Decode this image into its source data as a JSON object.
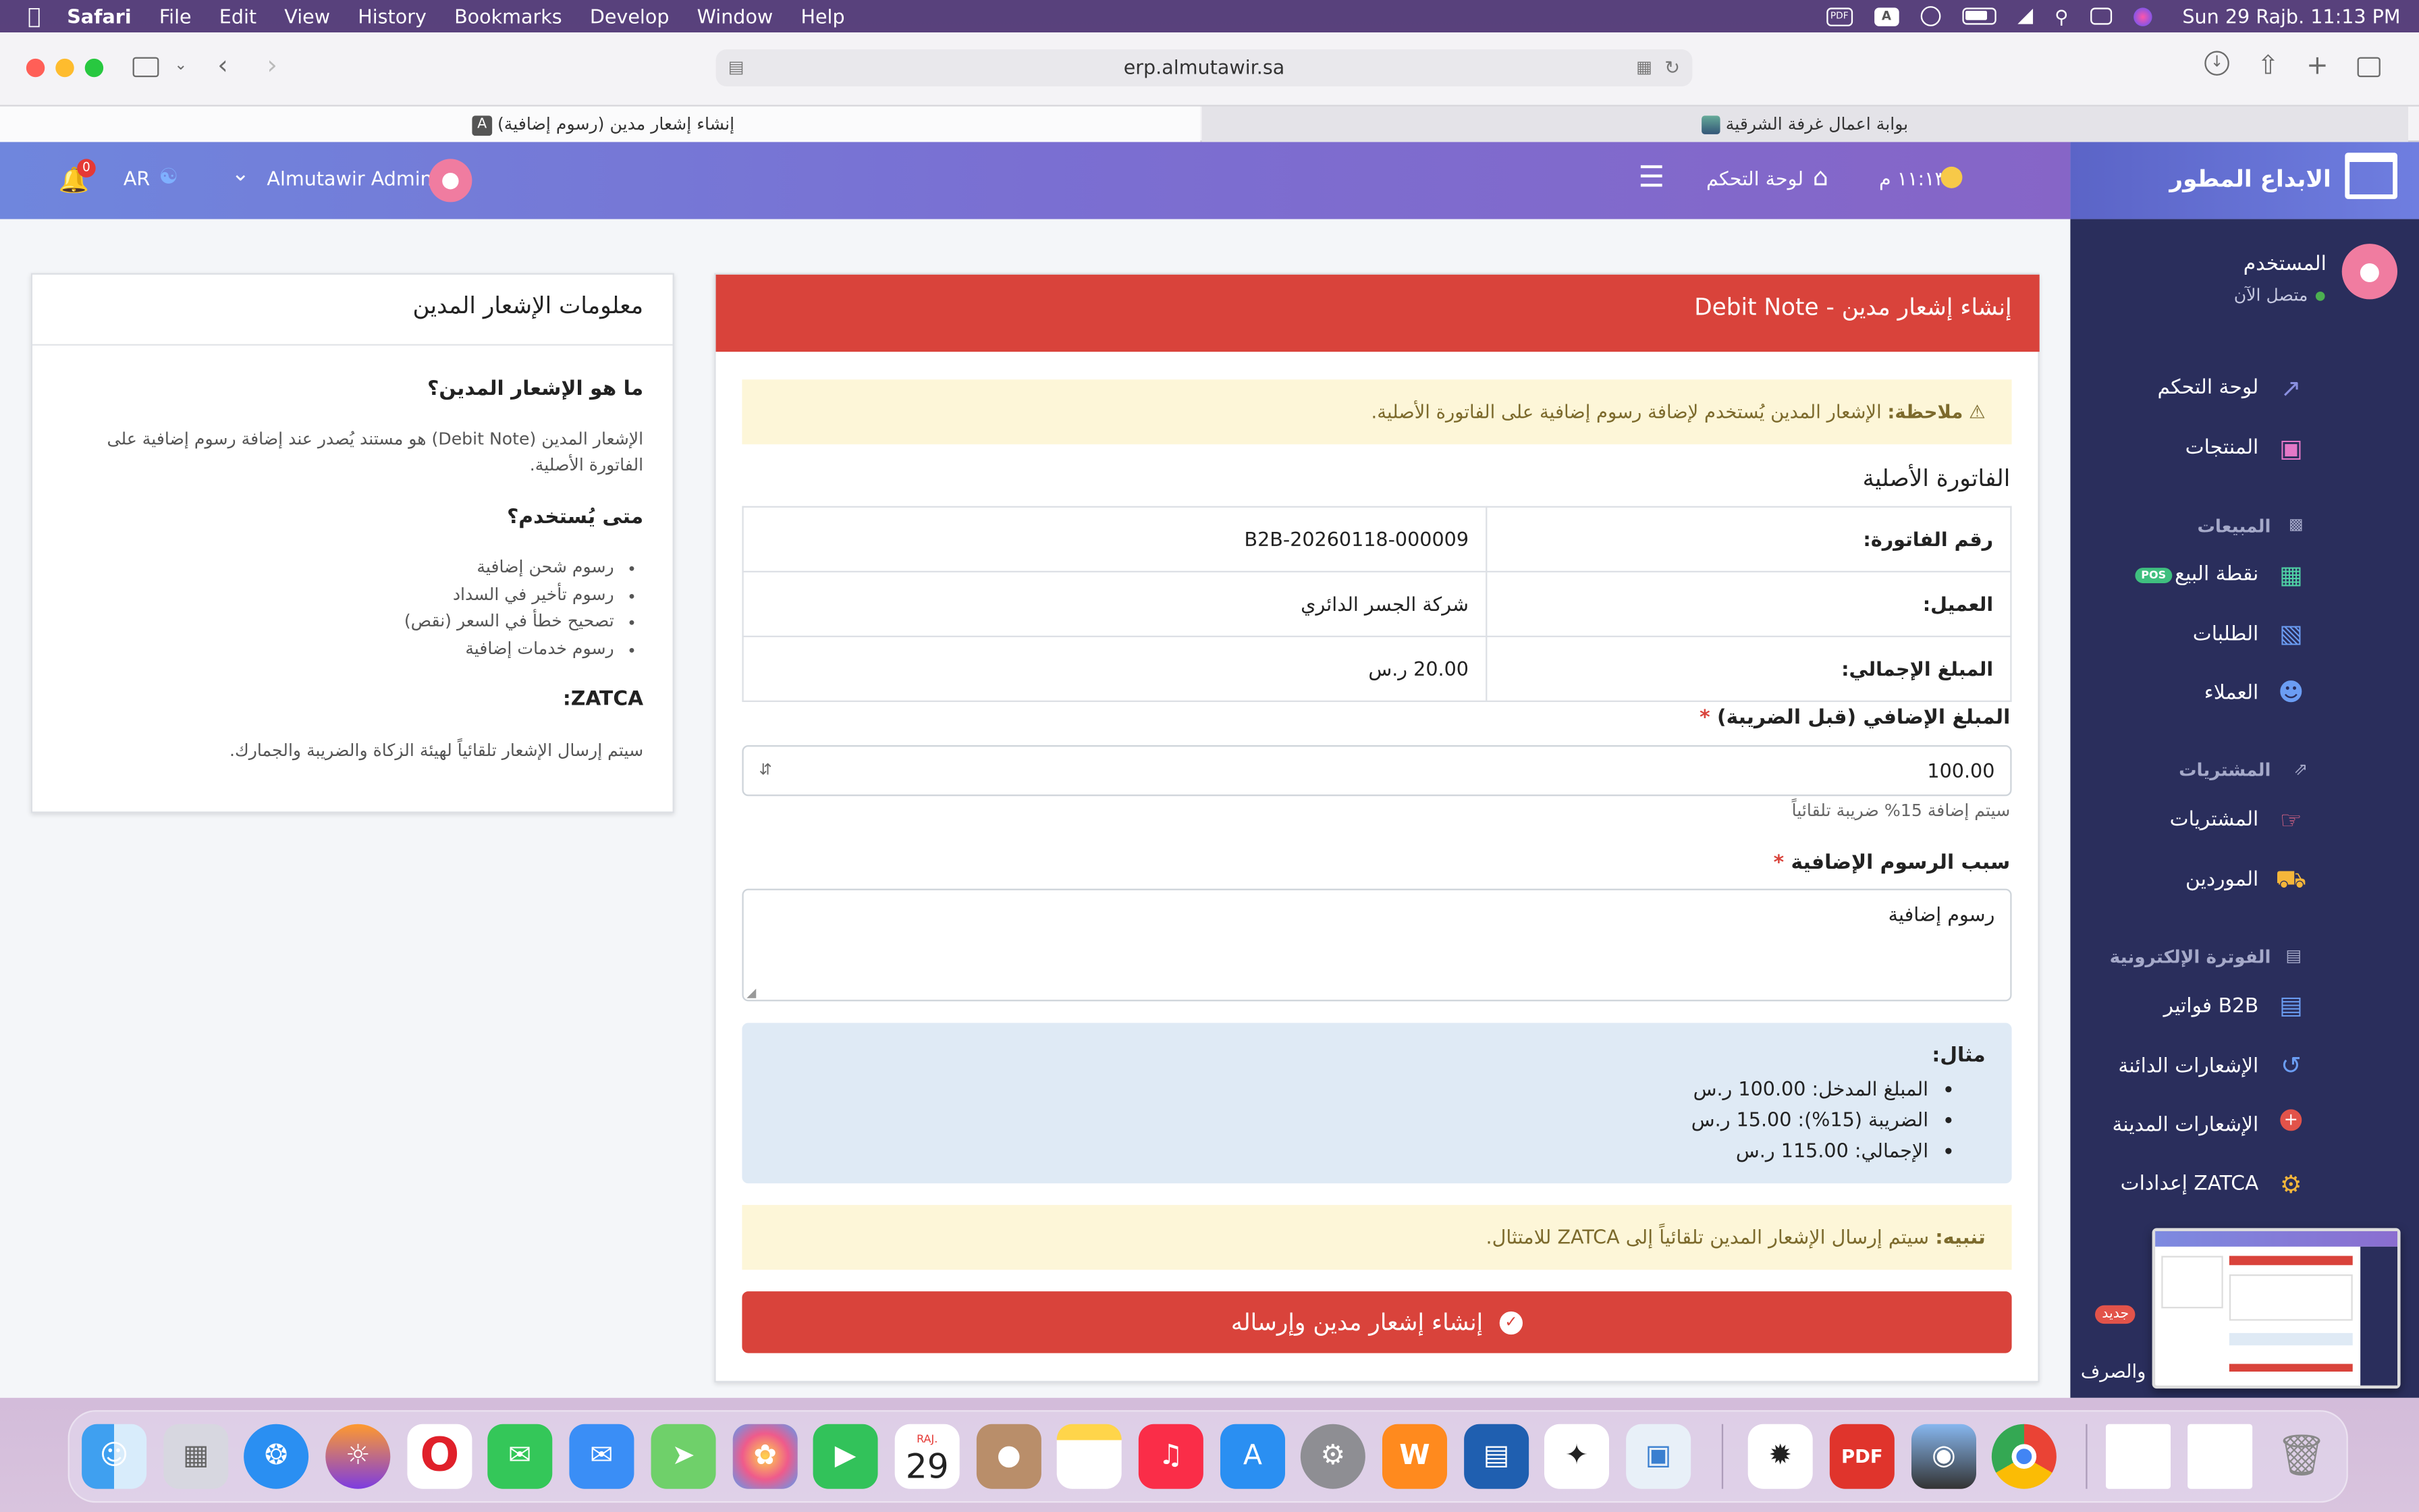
{
  "menubar": {
    "apple": "",
    "app": "Safari",
    "items": [
      "File",
      "Edit",
      "View",
      "History",
      "Bookmarks",
      "Develop",
      "Window",
      "Help"
    ],
    "pdf_badge": "PDF",
    "a_badge": "A",
    "datetime": "Sun 29 Rajb.  11:13 PM"
  },
  "browser": {
    "url": "erp.almutawir.sa",
    "tabs": [
      {
        "title": "إنشاء إشعار مدين (رسوم إضافية)",
        "fav": "A"
      },
      {
        "title": "بوابة اعمال غرفة الشرقية"
      }
    ]
  },
  "topnav": {
    "notif_count": "0",
    "lang": "AR",
    "user": "Almutawir Admin",
    "dashboard": "لوحة التحكم",
    "time": "١١:١٣ م"
  },
  "sidebar": {
    "brand": "الابداع المطور",
    "user_name": "المستخدم",
    "user_status": "متصل الآن",
    "items": [
      {
        "label": "لوحة التحكم"
      },
      {
        "label": "المنتجات"
      },
      {
        "section": "المبيعات"
      },
      {
        "label": "نقطة البيع",
        "badge": "POS"
      },
      {
        "label": "الطلبات"
      },
      {
        "label": "العملاء"
      },
      {
        "section": "المشتريات"
      },
      {
        "label": "المشتريات"
      },
      {
        "label": "الموردين"
      },
      {
        "section": "الفوترة الإلكترونية"
      },
      {
        "label": "فواتير B2B"
      },
      {
        "label": "الإشعارات الدائنة"
      },
      {
        "label": "الإشعارات المدينة"
      },
      {
        "label": "إعدادات ZATCA"
      }
    ],
    "partial_1": "ة",
    "partial_1_badge": "جديد",
    "partial_2": "والصرف"
  },
  "form": {
    "title": "إنشاء إشعار مدين - Debit Note",
    "note_label": "ملاحظة:",
    "note_text": " الإشعار المدين يُستخدم لإضافة رسوم إضافية على الفاتورة الأصلية.",
    "original_invoice": "الفاتورة الأصلية",
    "rows": [
      {
        "label": "رقم الفاتورة:",
        "value": "B2B-20260118-000009"
      },
      {
        "label": "العميل:",
        "value": "شركة الجسر الدائري"
      },
      {
        "label": "المبلغ الإجمالي:",
        "value": "20.00 ر.س"
      }
    ],
    "amount_label": "المبلغ الإضافي (قبل الضريبة)",
    "amount_value": "100.00",
    "amount_help": "سيتم إضافة 15% ضريبة تلقائياً",
    "reason_label": "سبب الرسوم الإضافية",
    "reason_value": "رسوم إضافية",
    "example_title": "مثال:",
    "example_items": [
      "المبلغ المدخل: 100.00 ر.س",
      "الضريبة (15%): 15.00 ر.س",
      "الإجمالي: 115.00 ر.س"
    ],
    "warn_label": "تنبيه:",
    "warn_text": " سيتم إرسال الإشعار المدين تلقائياً إلى ZATCA للامتثال.",
    "submit": "إنشاء إشعار مدين وإرساله"
  },
  "info": {
    "title": "معلومات الإشعار المدين",
    "q1": "ما هو الإشعار المدين؟",
    "a1": "الإشعار المدين (Debit Note) هو مستند يُصدر عند إضافة رسوم إضافية على الفاتورة الأصلية.",
    "q2": "متى يُستخدم؟",
    "uses": [
      "رسوم شحن إضافية",
      "رسوم تأخير في السداد",
      "تصحيح خطأ في السعر (نقص)",
      "رسوم خدمات إضافية"
    ],
    "q3": "ZATCA:",
    "a3": "سيتم إرسال الإشعار تلقائياً لهيئة الزكاة والضريبة والجمارك."
  },
  "dock": {
    "calendar_month": "RAJ.",
    "calendar_day": "29"
  },
  "colors": {
    "danger": "#d9433b",
    "sidebar_bg": "#2a2e5c",
    "nav_start": "#6f86dd",
    "nav_end": "#8665c7",
    "warning_bg": "#fdf6d8",
    "info_bg": "#dfeaf5"
  }
}
